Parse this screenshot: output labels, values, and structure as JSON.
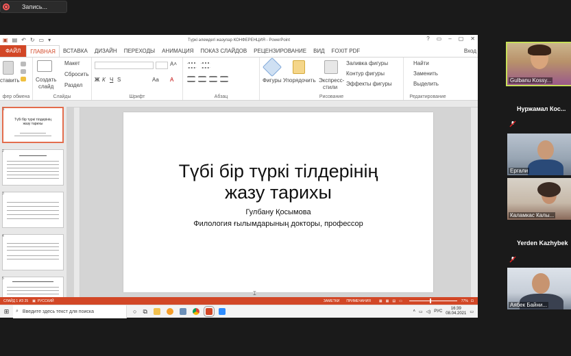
{
  "recording": {
    "label": "Запись..."
  },
  "powerpoint": {
    "window_title": "Түркі әлемдегі жазулар КОНФЕРЕНЦИЯ - PowerPoint",
    "window_controls": [
      "?",
      "▭",
      "–",
      "▢",
      "✕"
    ],
    "tabs": [
      "ФАЙЛ",
      "ГЛАВНАЯ",
      "ВСТАВКА",
      "ДИЗАЙН",
      "ПЕРЕХОДЫ",
      "АНИМАЦИЯ",
      "ПОКАЗ СЛАЙДОВ",
      "РЕЦЕНЗИРОВАНИЕ",
      "ВИД",
      "FOXIT PDF"
    ],
    "active_tab": "ГЛАВНАЯ",
    "signin": "Вход",
    "ribbon": {
      "clipboard": {
        "paste": "ставить",
        "label": "фер обмена"
      },
      "slides": {
        "new_slide": "Создать",
        "new_slide2": "слайд",
        "layout": "Макет",
        "reset": "Сбросить",
        "section": "Раздел",
        "label": "Слайды"
      },
      "font": {
        "bold": "Ж",
        "italic": "К",
        "underline": "Ч",
        "strike": "S",
        "aa": "Aa",
        "label": "Шрифт"
      },
      "paragraph": {
        "label": "Абзац"
      },
      "drawing": {
        "shapes": "Фигуры",
        "arrange": "Упорядочить",
        "quick_styles": "Экспресс-",
        "quick_styles2": "стили",
        "fill": "Заливка фигуры",
        "outline": "Контур фигуры",
        "effects": "Эффекты фигуры",
        "label": "Рисование"
      },
      "editing": {
        "find": "Найти",
        "replace": "Заменить",
        "select": "Выделить",
        "label": "Редактирование"
      }
    },
    "slide": {
      "title_line1": "Түбі бір түркі тілдерінің",
      "title_line2": "жазу тарихы",
      "author": "Гулбану Қосымова",
      "degree": "Филология ғылымдарының докторы, профессор"
    },
    "thumbnails": [
      {
        "num": "1",
        "title": "Түбі бір түркі тілдерінің жазу тарихы"
      },
      {
        "num": "2",
        "title": ""
      },
      {
        "num": "3",
        "title": ""
      },
      {
        "num": "4",
        "title": ""
      },
      {
        "num": "5",
        "title": ""
      }
    ],
    "status": {
      "slide_info": "СЛАЙД 1 ИЗ 25",
      "language": "РУССКИЙ",
      "notes": "ЗАМЕТКИ",
      "comments": "ПРИМЕЧАНИЯ",
      "zoom": "77%"
    }
  },
  "taskbar": {
    "search_placeholder": "Введите здесь текст для поиска",
    "lang": "РУС",
    "time": "16:39",
    "date": "08.04.2021"
  },
  "participants": [
    {
      "name": "Gulbanu Kossy...",
      "type": "video",
      "active": true
    },
    {
      "name": "Нуржамал  Кос...",
      "type": "text"
    },
    {
      "name": "Ергали",
      "type": "video"
    },
    {
      "name": "Каламкас Калы...",
      "type": "video"
    },
    {
      "name": "Yerden Kazhybek",
      "type": "text"
    },
    {
      "name": "Аябек Байни...",
      "type": "video"
    }
  ],
  "colors": {
    "ppt_accent": "#d24726",
    "active_speaker": "#c8e05a",
    "mute_red": "#e02020"
  }
}
